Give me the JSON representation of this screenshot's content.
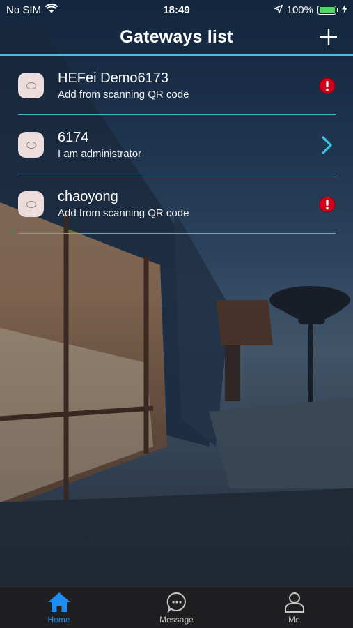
{
  "status_bar": {
    "carrier": "No SIM",
    "time": "18:49",
    "battery_percent": "100%",
    "battery_level": 1.0,
    "icons": [
      "wifi-icon",
      "location-arrow-icon",
      "battery-icon",
      "charging-bolt-icon"
    ]
  },
  "nav": {
    "title": "Gateways list",
    "add_icon": "plus-icon"
  },
  "gateways": [
    {
      "name": "HEFei Demo6173",
      "subtitle": "Add from scanning QR code",
      "status_icon": "alert-icon"
    },
    {
      "name": "6174",
      "subtitle": "I am administrator",
      "status_icon": "chevron-right-icon"
    },
    {
      "name": "chaoyong",
      "subtitle": "Add from scanning QR code",
      "status_icon": "alert-icon"
    }
  ],
  "tabs": [
    {
      "label": "Home",
      "icon": "home-icon",
      "active": true
    },
    {
      "label": "Message",
      "icon": "message-icon",
      "active": false
    },
    {
      "label": "Me",
      "icon": "person-icon",
      "active": false
    }
  ],
  "colors": {
    "accent": "#39c6e6",
    "alert": "#d0021b",
    "tab_active": "#1e8ef5",
    "tab_inactive": "#c7c7c7",
    "tab_bar_bg": "#1f1f21"
  }
}
